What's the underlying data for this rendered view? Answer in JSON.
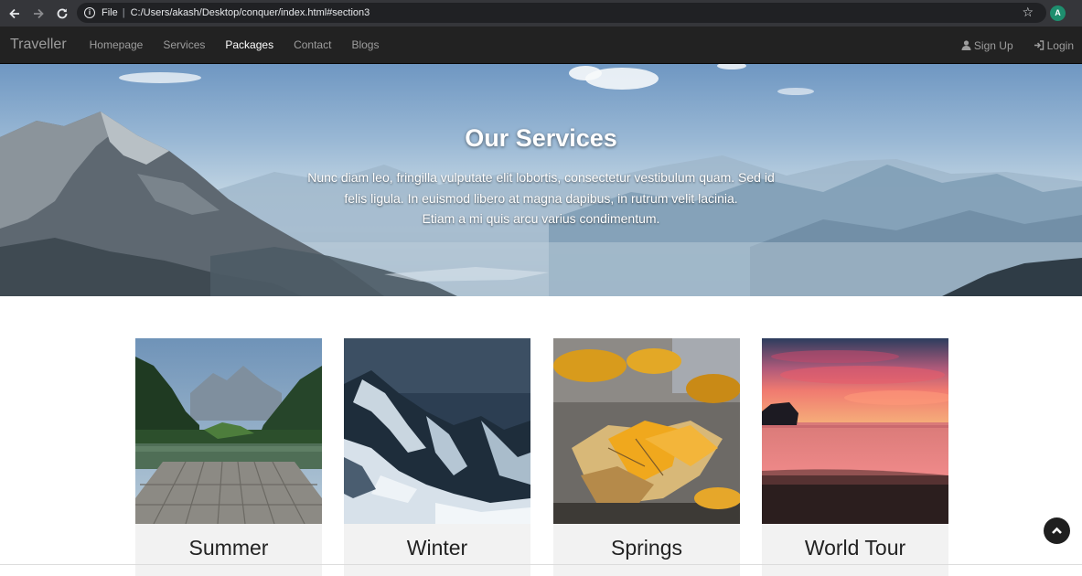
{
  "browser": {
    "scheme_label": "File",
    "separator": "|",
    "url": "C:/Users/akash/Desktop/conquer/index.html#section3",
    "avatar_initial": "A"
  },
  "navbar": {
    "brand": "Traveller",
    "links": [
      "Homepage",
      "Services",
      "Packages",
      "Contact",
      "Blogs"
    ],
    "active_link": "Packages",
    "signup": "Sign Up",
    "login": "Login"
  },
  "hero": {
    "title": "Our Services",
    "text_lines": [
      "Nunc diam leo, fringilla vulputate elit lobortis, consectetur vestibulum quam. Sed id",
      "felis ligula. In euismod libero at magna dapibus, in rutrum velit lacinia.",
      "Etiam a mi quis arcu varius condimentum."
    ]
  },
  "packages": [
    {
      "label": "Summer"
    },
    {
      "label": "Winter"
    },
    {
      "label": "Springs"
    },
    {
      "label": "World Tour"
    }
  ],
  "colors": {
    "navbar_bg": "#222222",
    "nav_text": "#9d9d9d",
    "nav_active": "#ffffff",
    "card_bg": "#f2f2f2"
  },
  "icons": [
    "back-arrow-icon",
    "forward-arrow-icon",
    "reload-icon",
    "info-icon",
    "star-icon",
    "user-icon",
    "login-icon",
    "chevron-up-icon"
  ]
}
